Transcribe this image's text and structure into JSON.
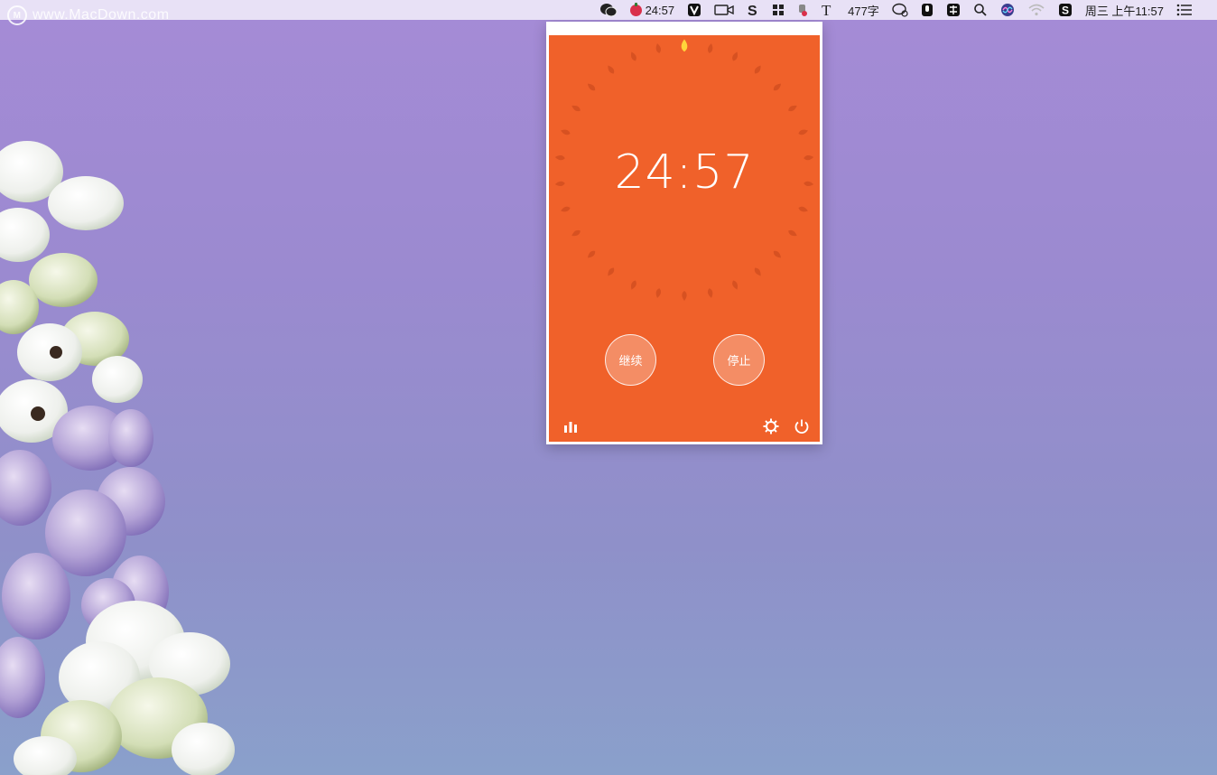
{
  "watermark": {
    "text": "www.MacDown.com"
  },
  "menubar": {
    "items": [
      {
        "icon": "wechat-icon"
      },
      {
        "icon": "tomato-timer-icon",
        "label": "24:57"
      },
      {
        "icon": "v-logo-icon"
      },
      {
        "icon": "video-camera-icon"
      },
      {
        "icon": "s-app-icon"
      },
      {
        "icon": "bookmark-grid-icon"
      },
      {
        "icon": "hand-record-icon"
      },
      {
        "icon": "text-t-icon"
      },
      {
        "icon": "word-count",
        "label": "477字"
      },
      {
        "icon": "chat-bubble-icon"
      },
      {
        "icon": "microphone-icon"
      },
      {
        "icon": "input-method-icon"
      },
      {
        "icon": "search-icon"
      },
      {
        "icon": "siri-icon"
      },
      {
        "icon": "wifi-icon"
      },
      {
        "icon": "sogou-icon"
      }
    ],
    "clock": "周三 上午11:57",
    "menu_icon": "list-icon"
  },
  "timer": {
    "remaining": "24:57",
    "continue_label": "继续",
    "stop_label": "停止",
    "progress_ticks_done": 1,
    "progress_ticks_total": 30,
    "colors": {
      "panel": "#f0612a",
      "active_tick": "#ffd43b"
    },
    "footer": {
      "stats_icon": "bar-chart-icon",
      "settings_icon": "gear-icon",
      "power_icon": "power-icon"
    }
  }
}
